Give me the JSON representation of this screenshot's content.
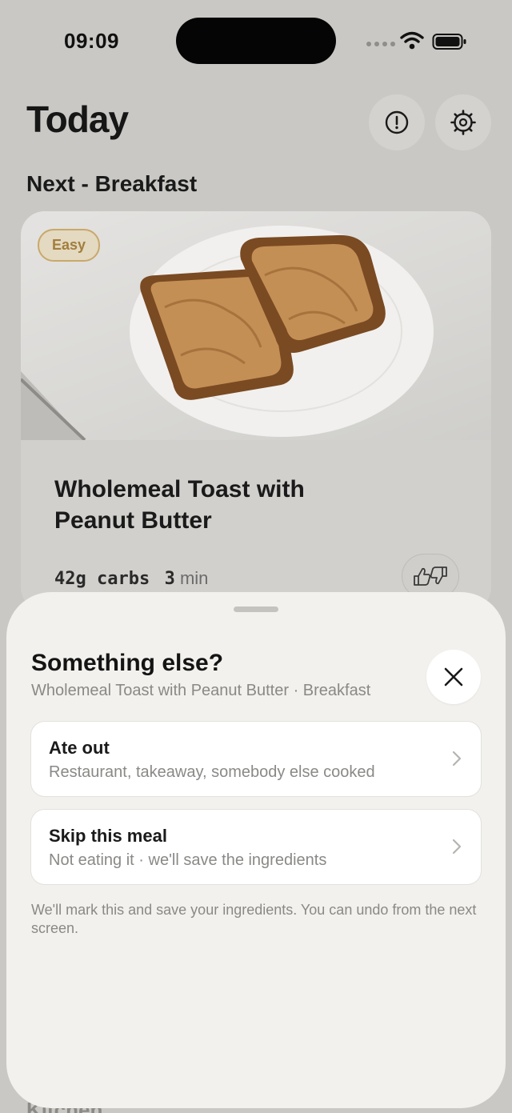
{
  "status_bar": {
    "time": "09:09"
  },
  "header": {
    "title": "Today"
  },
  "section": {
    "title": "Next - Breakfast"
  },
  "meal_card": {
    "badge": "Easy",
    "title": "Wholemeal Toast with Peanut Butter",
    "carbs": "42g carbs",
    "time_value": "3",
    "time_unit": "min"
  },
  "next_section_peek": "Kitchen",
  "sheet": {
    "title": "Something else?",
    "subtitle": "Wholemeal Toast with Peanut Butter · Breakfast",
    "options": [
      {
        "label": "Ate out",
        "description": "Restaurant, takeaway, somebody else cooked"
      },
      {
        "label": "Skip this meal",
        "description": "Not eating it · we'll save the ingredients"
      }
    ],
    "note": "We'll mark this and save your ingredients. You can undo from the next screen."
  },
  "icons": {
    "alert": "alert-circle-icon",
    "settings": "gear-icon",
    "feedback": "thumbs-up-down-icon",
    "close": "close-icon",
    "chevron": "chevron-right-icon"
  },
  "colors": {
    "background_dimmed": "#c9c8c4",
    "sheet_background": "#f2f1ed",
    "badge_accent": "#a27e3c"
  }
}
